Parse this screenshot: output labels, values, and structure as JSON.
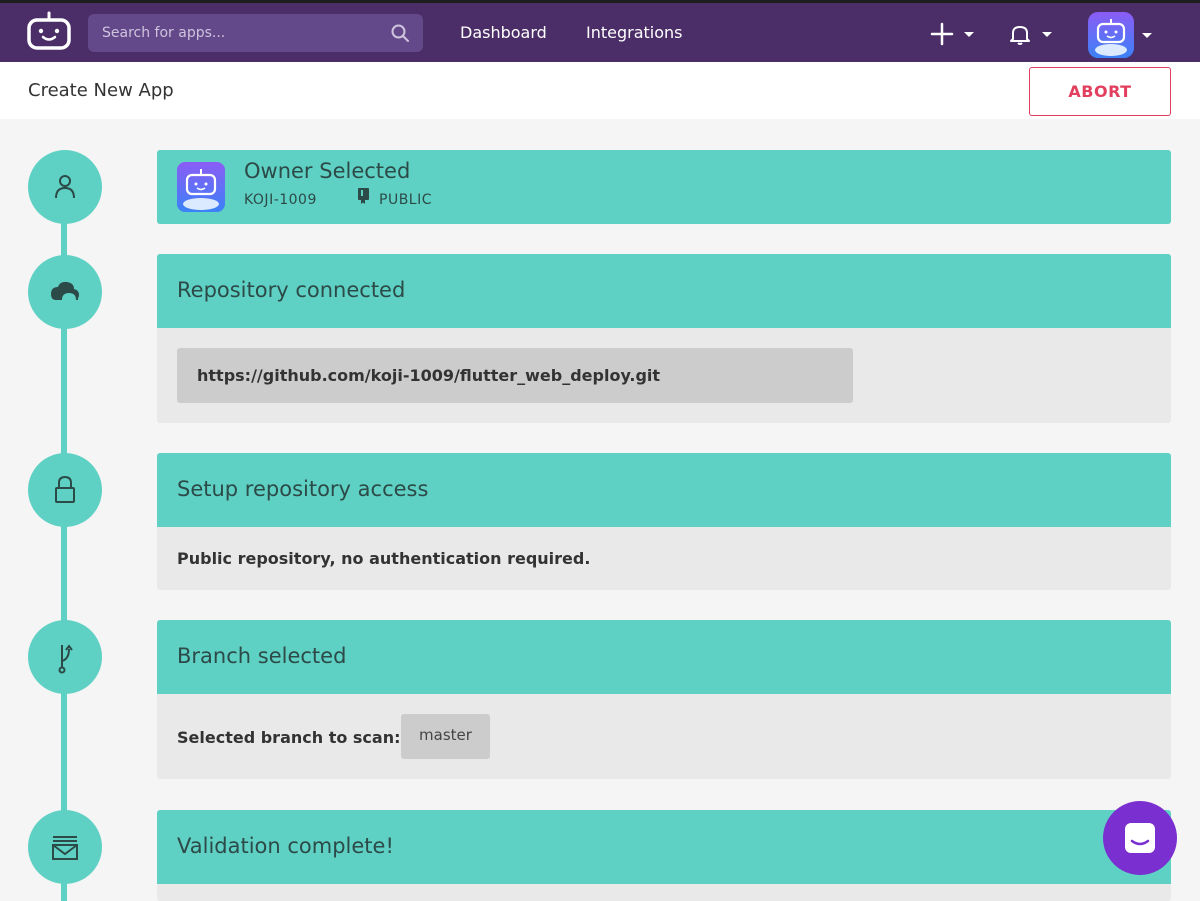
{
  "topbar": {
    "search_placeholder": "Search for apps...",
    "nav": {
      "dashboard": "Dashboard",
      "integrations": "Integrations"
    },
    "icons": [
      "logo-icon",
      "search-icon",
      "plus-icon",
      "bell-icon",
      "chevron-down-icon",
      "avatar"
    ]
  },
  "subheader": {
    "title": "Create New App",
    "abort_label": "ABORT"
  },
  "steps": {
    "owner": {
      "title": "Owner Selected",
      "name": "KOJI-1009",
      "visibility": "PUBLIC"
    },
    "repository": {
      "title": "Repository connected",
      "url": "https://github.com/koji-1009/flutter_web_deploy.git"
    },
    "access": {
      "title": "Setup repository access",
      "text": "Public repository, no authentication required."
    },
    "branch": {
      "title": "Branch selected",
      "label": "Selected branch to scan:",
      "value": "master"
    },
    "validation": {
      "title": "Validation complete!"
    }
  },
  "colors": {
    "brand_purple": "#4b2e67",
    "teal": "#5fd1c4",
    "abort_red": "#e23f5f",
    "chat_purple": "#7a2fd0"
  }
}
